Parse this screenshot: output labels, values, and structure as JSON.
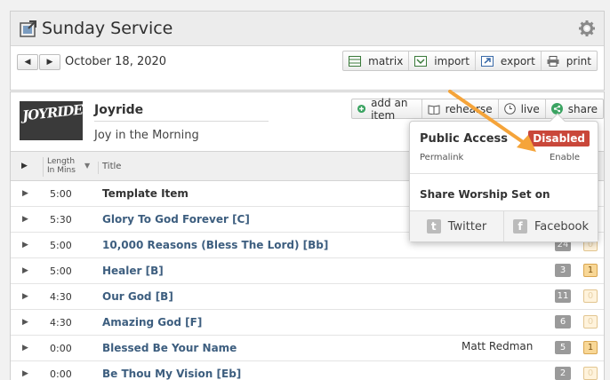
{
  "header": {
    "title": "Sunday Service",
    "date": "October 18, 2020",
    "prev_icon": "◀",
    "next_icon": "▶",
    "tools": [
      "matrix",
      "import",
      "export",
      "print"
    ]
  },
  "set": {
    "artwork_text": "JOYRIDE",
    "name": "Joyride",
    "subtitle": "Joy in the Morning",
    "actions": [
      "add an item",
      "rehearse",
      "live",
      "share"
    ]
  },
  "table": {
    "expand_icon": "▶",
    "sort_icon": "▼",
    "col_length": [
      "Length",
      "In Mins"
    ],
    "col_title": "Title",
    "rows": [
      {
        "length": "5:00",
        "title": "Template Item",
        "artist": "",
        "badge1": "",
        "badge2": ""
      },
      {
        "length": "5:30",
        "title": "Glory To God Forever [C]",
        "artist": "",
        "badge1": "",
        "badge2": ""
      },
      {
        "length": "5:00",
        "title": "10,000 Reasons (Bless The Lord) [Bb]",
        "artist": "",
        "badge1": "24",
        "badge2": "0"
      },
      {
        "length": "5:00",
        "title": "Healer [B]",
        "artist": "",
        "badge1": "3",
        "badge2": "1"
      },
      {
        "length": "4:30",
        "title": "Our God [B]",
        "artist": "",
        "badge1": "11",
        "badge2": "0"
      },
      {
        "length": "4:30",
        "title": "Amazing God [F]",
        "artist": "",
        "badge1": "6",
        "badge2": "0"
      },
      {
        "length": "0:00",
        "title": "Blessed Be Your Name",
        "artist": "Matt Redman",
        "badge1": "5",
        "badge2": "1"
      },
      {
        "length": "0:00",
        "title": "Be Thou My Vision [Eb]",
        "artist": "",
        "badge1": "2",
        "badge2": "0"
      }
    ]
  },
  "share_popup": {
    "public_access_label": "Public Access",
    "status_badge": "Disabled",
    "permalink_label": "Permalink",
    "enable_label": "Enable",
    "share_title": "Share Worship Set on",
    "twitter_label": "Twitter",
    "facebook_label": "Facebook",
    "twitter_glyph": "t",
    "facebook_glyph": "f"
  },
  "colors": {
    "disabled_badge": "#c9473a",
    "song_title": "#3d5e7f",
    "annotation_arrow": "#f5a43a",
    "share_icon": "#3aa361",
    "add_icon": "#3aa361"
  }
}
